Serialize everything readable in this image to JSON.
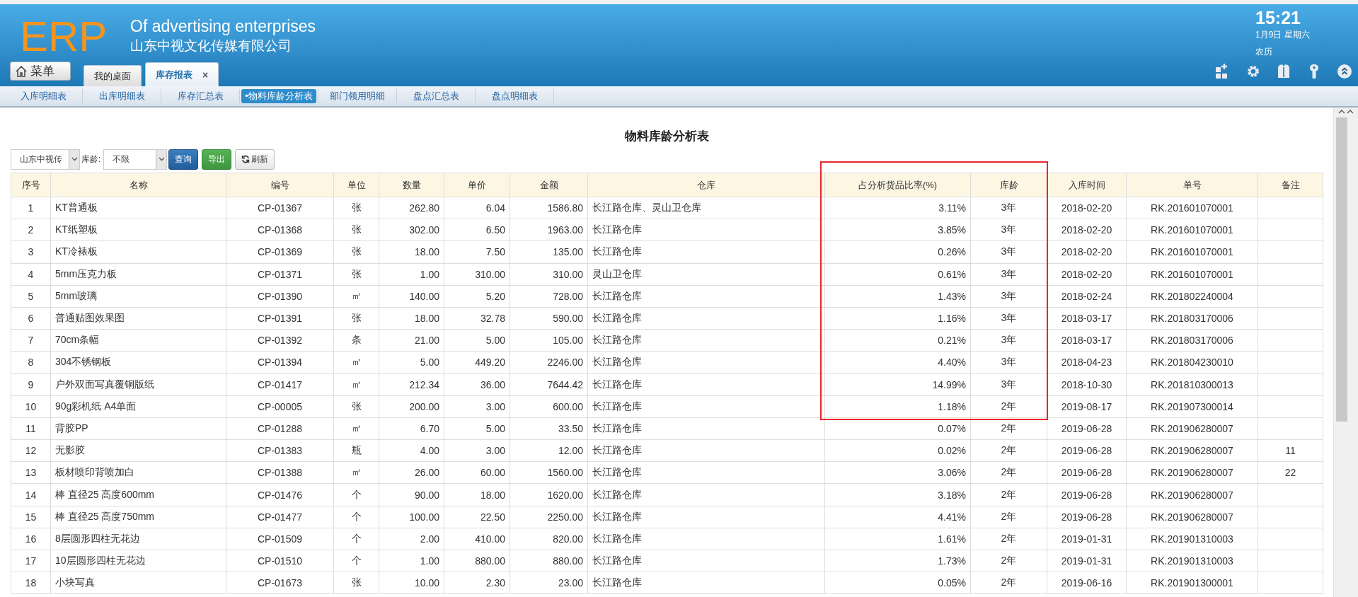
{
  "header": {
    "logo": "ERP",
    "subtitle": "Of advertising enterprises",
    "company": "山东中视文化传媒有限公司",
    "menu_button": "菜单",
    "tabs": [
      {
        "label": "我的桌面",
        "selected": false
      },
      {
        "label": "库存报表",
        "selected": true,
        "close": "×"
      }
    ],
    "clock": {
      "time": "15:21",
      "date": "1月9日 星期六",
      "lunar": "农历"
    },
    "tools": [
      {
        "kind": "grid-add"
      },
      {
        "kind": "settings"
      },
      {
        "kind": "shirt"
      },
      {
        "kind": "key"
      },
      {
        "kind": "collapse"
      }
    ]
  },
  "subnav": [
    {
      "label": "入库明细表",
      "selected": false
    },
    {
      "label": "出库明细表",
      "selected": false
    },
    {
      "label": "库存汇总表",
      "selected": false
    },
    {
      "label": "•物料库龄分析表",
      "selected": true
    },
    {
      "label": "部门领用明细",
      "selected": false
    },
    {
      "label": "盘点汇总表",
      "selected": false
    },
    {
      "label": "盘点明细表",
      "selected": false
    }
  ],
  "report": {
    "title": "物料库龄分析表",
    "toolbar": {
      "company_select": "山东中视传",
      "age_label": "库龄:",
      "age_select": "不限",
      "buttons": [
        {
          "kind": "primary",
          "label": "查询"
        },
        {
          "kind": "success",
          "label": "导出"
        },
        {
          "kind": "refresh",
          "label": "刷新"
        }
      ]
    },
    "table": {
      "columns": [
        "序号",
        "名称",
        "编号",
        "单位",
        "数量",
        "单价",
        "金额",
        "仓库",
        "占分析货品比率(%)",
        "库龄",
        "入库时间",
        "单号",
        "备注"
      ],
      "rows": [
        [
          "1",
          "KT普通板",
          "CP-01367",
          "张",
          "262.80",
          "6.04",
          "1586.80",
          "长江路仓库、灵山卫仓库",
          "3.11%",
          "3年",
          "2018-02-20",
          "RK.201601070001"
        ],
        [
          "2",
          "KT纸塑板",
          "CP-01368",
          "张",
          "302.00",
          "6.50",
          "1963.00",
          "长江路仓库",
          "3.85%",
          "3年",
          "2018-02-20",
          "RK.201601070001"
        ],
        [
          "3",
          "KT冷裱板",
          "CP-01369",
          "张",
          "18.00",
          "7.50",
          "135.00",
          "长江路仓库",
          "0.26%",
          "3年",
          "2018-02-20",
          "RK.201601070001"
        ],
        [
          "4",
          "5mm压克力板",
          "CP-01371",
          "张",
          "1.00",
          "310.00",
          "310.00",
          "灵山卫仓库",
          "0.61%",
          "3年",
          "2018-02-20",
          "RK.201601070001"
        ],
        [
          "5",
          "5mm玻璃",
          "CP-01390",
          "㎡",
          "140.00",
          "5.20",
          "728.00",
          "长江路仓库",
          "1.43%",
          "3年",
          "2018-02-24",
          "RK.201802240004"
        ],
        [
          "6",
          "普通贴图效果图",
          "CP-01391",
          "张",
          "18.00",
          "32.78",
          "590.00",
          "长江路仓库",
          "1.16%",
          "3年",
          "2018-03-17",
          "RK.201803170006"
        ],
        [
          "7",
          "70cm条幅",
          "CP-01392",
          "条",
          "21.00",
          "5.00",
          "105.00",
          "长江路仓库",
          "0.21%",
          "3年",
          "2018-03-17",
          "RK.201803170006"
        ],
        [
          "8",
          "304不锈钢板",
          "CP-01394",
          "㎡",
          "5.00",
          "449.20",
          "2246.00",
          "长江路仓库",
          "4.40%",
          "3年",
          "2018-04-23",
          "RK.201804230010"
        ],
        [
          "9",
          "户外双面写真覆铜版纸",
          "CP-01417",
          "㎡",
          "212.34",
          "36.00",
          "7644.42",
          "长江路仓库",
          "14.99%",
          "3年",
          "2018-10-30",
          "RK.201810300013"
        ],
        [
          "10",
          "90g彩机纸 A4单面",
          "CP-00005",
          "张",
          "200.00",
          "3.00",
          "600.00",
          "长江路仓库",
          "1.18%",
          "2年",
          "2019-08-17",
          "RK.201907300014"
        ],
        [
          "11",
          "背胶PP",
          "CP-01288",
          "㎡",
          "6.70",
          "5.00",
          "33.50",
          "长江路仓库",
          "0.07%",
          "2年",
          "2019-06-28",
          "RK.201906280007"
        ],
        [
          "12",
          "无影胶",
          "CP-01383",
          "瓶",
          "4.00",
          "3.00",
          "12.00",
          "长江路仓库",
          "0.02%",
          "2年",
          "2019-06-28",
          "RK.201906280007",
          "11"
        ],
        [
          "13",
          "板材喷印背喷加白",
          "CP-01388",
          "㎡",
          "26.00",
          "60.00",
          "1560.00",
          "长江路仓库",
          "3.06%",
          "2年",
          "2019-06-28",
          "RK.201906280007",
          "22"
        ],
        [
          "14",
          "棒 直径25 高度600mm",
          "CP-01476",
          "个",
          "90.00",
          "18.00",
          "1620.00",
          "长江路仓库",
          "3.18%",
          "2年",
          "2019-06-28",
          "RK.201906280007"
        ],
        [
          "15",
          "棒 直径25 高度750mm",
          "CP-01477",
          "个",
          "100.00",
          "22.50",
          "2250.00",
          "长江路仓库",
          "4.41%",
          "2年",
          "2019-06-28",
          "RK.201906280007"
        ],
        [
          "16",
          "8层圆形四柱无花边",
          "CP-01509",
          "个",
          "2.00",
          "410.00",
          "820.00",
          "长江路仓库",
          "1.61%",
          "2年",
          "2019-01-31",
          "RK.201901310003"
        ],
        [
          "17",
          "10层圆形四柱无花边",
          "CP-01510",
          "个",
          "1.00",
          "880.00",
          "880.00",
          "长江路仓库",
          "1.73%",
          "2年",
          "2019-01-31",
          "RK.201901310003"
        ],
        [
          "18",
          "小块写真",
          "CP-01673",
          "张",
          "10.00",
          "2.30",
          "23.00",
          "长江路仓库",
          "0.05%",
          "2年",
          "2019-06-16",
          "RK.201901300001"
        ]
      ]
    },
    "annotation": {
      "kind": "rectangle",
      "color": "#e8262a"
    }
  }
}
